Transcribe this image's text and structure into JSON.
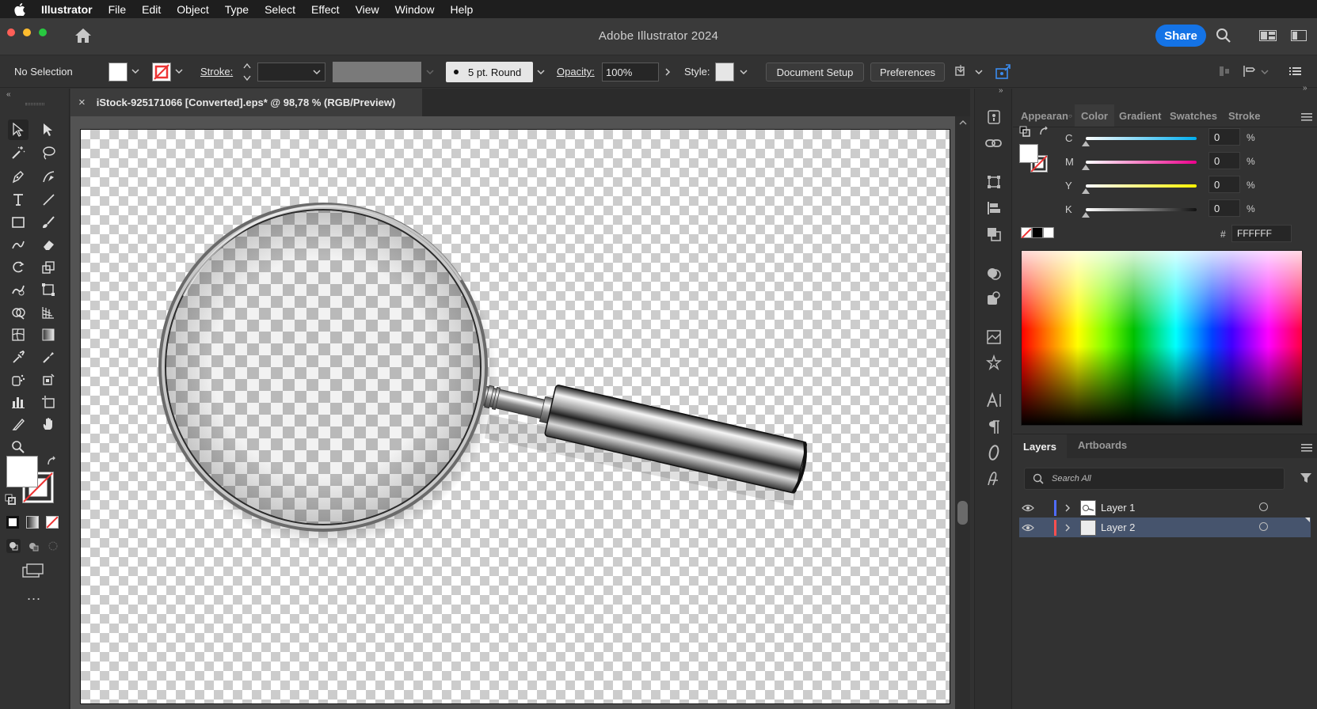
{
  "menubar": {
    "app_name": "Illustrator",
    "items": [
      "File",
      "Edit",
      "Object",
      "Type",
      "Select",
      "Effect",
      "View",
      "Window",
      "Help"
    ]
  },
  "window": {
    "title": "Adobe Illustrator 2024",
    "share_label": "Share"
  },
  "control_bar": {
    "selection_label": "No Selection",
    "stroke_label": "Stroke:",
    "brush_label": "5 pt. Round",
    "opacity_label": "Opacity:",
    "opacity_value": "100%",
    "style_label": "Style:",
    "document_setup_label": "Document Setup",
    "preferences_label": "Preferences"
  },
  "document": {
    "tab_title": "iStock-925171066 [Converted].eps* @ 98,78 % (RGB/Preview)",
    "close_glyph": "×"
  },
  "color_panel": {
    "tabs": [
      "Appearan",
      "Color",
      "Gradient",
      "Swatches",
      "Stroke"
    ],
    "active_tab": "Color",
    "sliders": [
      {
        "label": "C",
        "value": "0",
        "unit": "%"
      },
      {
        "label": "M",
        "value": "0",
        "unit": "%"
      },
      {
        "label": "Y",
        "value": "0",
        "unit": "%"
      },
      {
        "label": "K",
        "value": "0",
        "unit": "%"
      }
    ],
    "hash_label": "#",
    "hex_value": "FFFFFF"
  },
  "layers_panel": {
    "tabs": [
      "Layers",
      "Artboards"
    ],
    "active_tab": "Layers",
    "search_placeholder": "Search All",
    "layers": [
      {
        "name": "Layer 1",
        "color": "#4f6cff",
        "selected": false
      },
      {
        "name": "Layer 2",
        "color": "#ff4f4f",
        "selected": true
      }
    ]
  },
  "colors": {
    "accent": "#1473e6",
    "selected_row": "#46546d"
  },
  "icons": {
    "more_tools": "..."
  }
}
